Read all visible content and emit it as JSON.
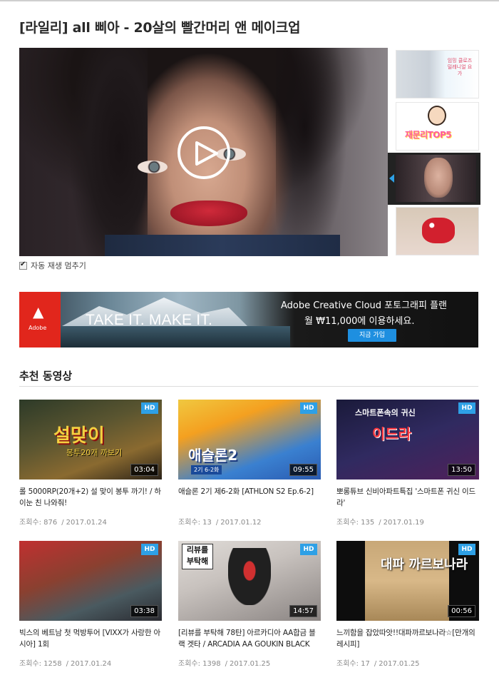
{
  "video": {
    "title": "[라일리] all 삐아 - 20살의 빨간머리 앤 메이크업",
    "autoplay_label": "자동 재생 멈추기",
    "autoplay_checked": true
  },
  "playlist": [
    {
      "caption": "임밍 클로즈 밀레니얼 요가"
    },
    {
      "caption": "재문리TOP5"
    },
    {
      "caption": ""
    },
    {
      "caption": ""
    }
  ],
  "banner": {
    "brand": "Adobe",
    "slogan": "TAKE IT. MAKE IT.",
    "line1": "Adobe Creative Cloud 포토그래피 플랜",
    "line2": "월 ₩11,000에 이용하세요.",
    "cta": "지금 가입"
  },
  "recommended": {
    "heading": "추천 동영상",
    "views_label": "조회수:",
    "videos": [
      {
        "title": "롤 5000RP(20개+2) 설 맞이 봉투 까기! / 하이눈 친 나와줘!",
        "views": "876",
        "date": "2017.01.24",
        "duration": "03:04",
        "badge": "HD",
        "thumb_text": "설맞이",
        "thumb_sub": "봉투20개 까보기"
      },
      {
        "title": "애슬론 2기 제6-2화 [ATHLON S2 Ep.6-2]",
        "views": "13",
        "date": "2017.01.12",
        "duration": "09:55",
        "badge": "HD",
        "thumb_text": "애슬론2",
        "thumb_sub": "2기 6-2화"
      },
      {
        "title": "뽀롱튜브 신비아파트특집 '스마트폰 귀신 이드라'",
        "views": "135",
        "date": "2017.01.19",
        "duration": "13:50",
        "badge": "HD",
        "thumb_text": "이드라",
        "thumb_sub": "스마트폰속의 귀신"
      },
      {
        "title": "빅스의 베트남 첫 먹방투어 [VIXX가 사랑한 아시아] 1회",
        "views": "1258",
        "date": "2017.01.24",
        "duration": "03:38",
        "badge": "HD",
        "thumb_text": "",
        "thumb_sub": ""
      },
      {
        "title": "[리뷰를 부탁해 78탄] 아르카디아 AA합금 블랙 겟타 / ARCADIA AA GOUKIN BLACK",
        "views": "1398",
        "date": "2017.01.25",
        "duration": "14:57",
        "badge": "HD",
        "thumb_text": "리뷰를 부탁해",
        "thumb_sub": ""
      },
      {
        "title": "느끼함을 잡았따앗!!대파까르보나라☆[만개의레시피]",
        "views": "17",
        "date": "2017.01.25",
        "duration": "00:56",
        "badge": "HD",
        "thumb_text": "대파 까르보나라",
        "thumb_sub": ""
      }
    ]
  },
  "colors": {
    "accent": "#2ea0e6",
    "adobe_red": "#e1261c"
  },
  "icons": {
    "play": "play-icon",
    "check": "checkbox-icon",
    "arrow": "current-arrow-icon"
  }
}
